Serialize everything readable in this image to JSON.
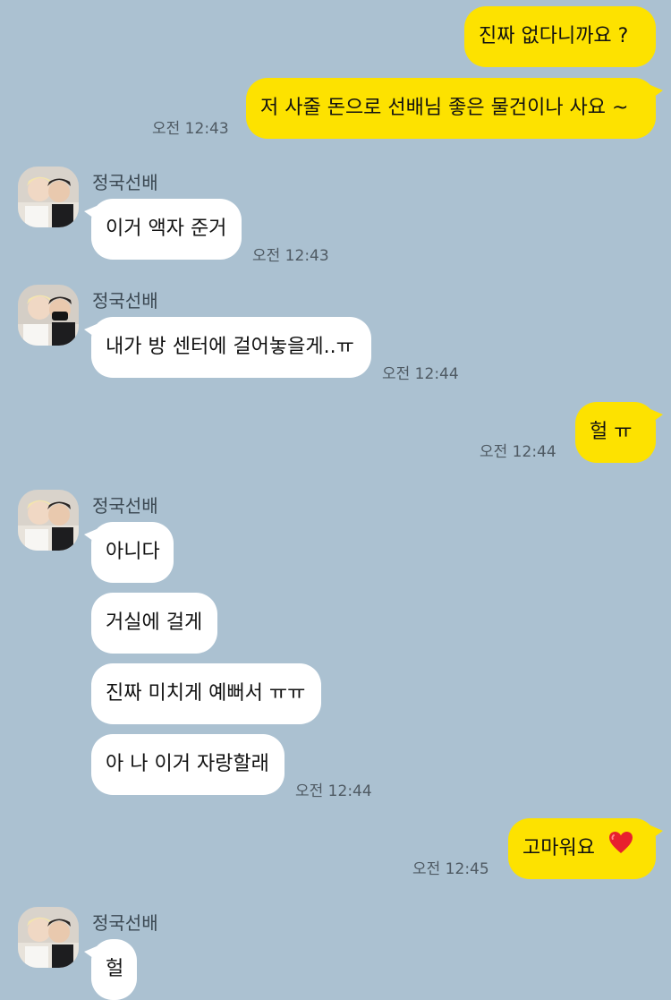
{
  "messages": {
    "m1": "진짜 없다니까요 ?",
    "m2": "저 사줄 돈으로 선배님 좋은 물건이나 사요 ~",
    "m3": "이거 액자 준거",
    "m4": "내가 방 센터에 걸어놓을게..ㅠ",
    "m5": "헐 ㅠ",
    "m6": "아니다",
    "m7": "거실에 걸게",
    "m8": "진짜 미치게 예뻐서 ㅠㅠ",
    "m9": "아 나 이거 자랑할래",
    "m10": "고마워요",
    "m11": "헐"
  },
  "times": {
    "t2": "오전 12:43",
    "t3": "오전 12:43",
    "t4": "오전 12:44",
    "t5": "오전 12:44",
    "t9": "오전 12:44",
    "t10": "오전 12:45"
  },
  "sender": {
    "name": "정국선배"
  },
  "colors": {
    "background": "#abc1d1",
    "my_bubble": "#fde200",
    "other_bubble": "#ffffff"
  },
  "icons": {
    "heart": "red-heart-icon"
  }
}
